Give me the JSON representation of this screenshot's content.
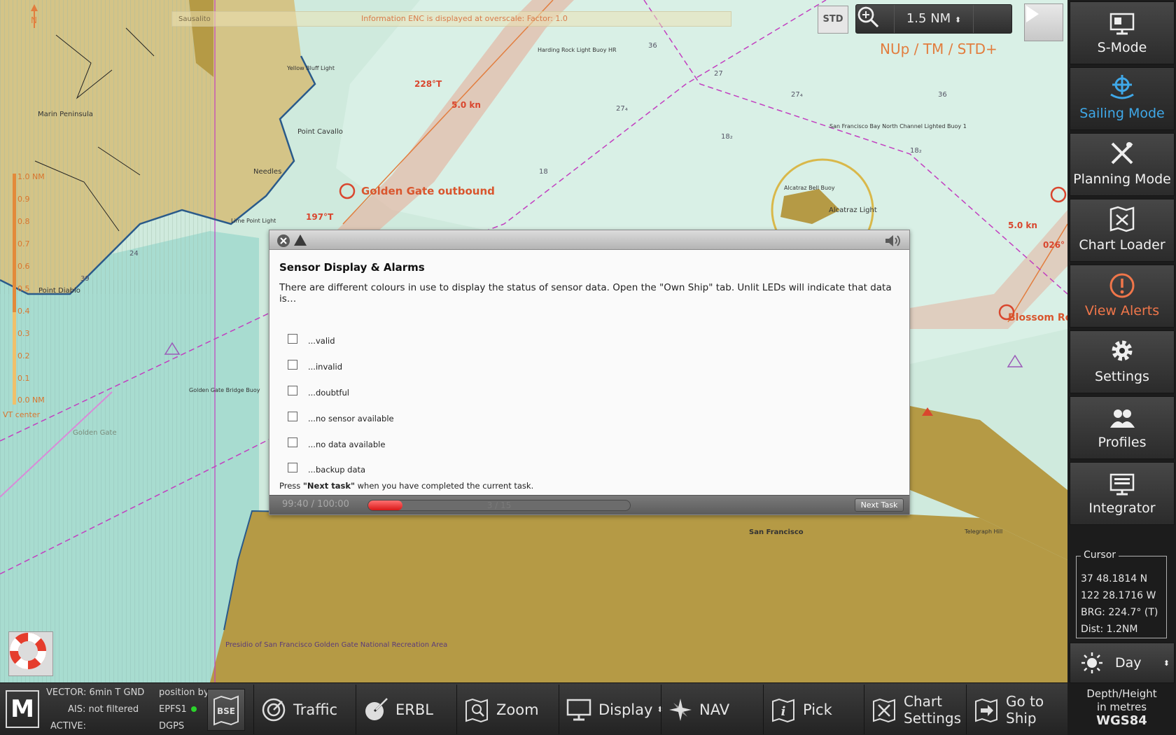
{
  "chart": {
    "info_banner": "Information ENC is displayed at overscale: Factor: 1.0",
    "place_sausalito": "Sausalito",
    "std_label": "STD",
    "zoom_value": "1.5 NM",
    "orientation_label": "NUp / TM / STD+",
    "labels": {
      "marin": "Marin Peninsula",
      "yellow_bluff": "Yellow Bluff Light",
      "point_cavallo": "Point Cavallo",
      "needles": "Needles",
      "point_diablo": "Point Diablo",
      "golden_gate_outbound": "Golden Gate outbound",
      "course_228": "228°T",
      "speed_5kn": "5.0 kn",
      "course_197": "197°T",
      "golden_gate": "Golden Gate",
      "golden_gate_bridge": "Golden Gate Bridge Buoy",
      "alcatraz": "Alcatraz Light",
      "alcatraz_bell": "Alcatraz Bell Buoy",
      "sf_bay_north": "San Francisco Bay North Channel Lighted Buoy 1",
      "blossom_rock": "Blossom Ro",
      "speed_right": "5.0 kn",
      "course_026": "026°",
      "harding": "Harding Rock Light Buoy HR",
      "lime_point": "Lime Point Light",
      "telegraph": "Telegraph Hill",
      "san_francisco": "San Francisco",
      "presidio": "Presidio of San Francisco Golden Gate National Recreation Area",
      "north": "N",
      "scale_top": "1.0 NM",
      "scale_bottom": "0.0 NM",
      "scale_ticks": [
        "0.9",
        "0.8",
        "0.7",
        "0.6",
        "0.5",
        "0.4",
        "0.3",
        "0.2",
        "0.1"
      ],
      "vct_center": "VT center",
      "depth_labels": [
        "36",
        "27",
        "18",
        "24",
        "39",
        "27₄",
        "18₂",
        "36",
        "27₄",
        "18₂"
      ]
    }
  },
  "dialog": {
    "title": "Sensor Display & Alarms",
    "description": "There are different colours in use to display the status of sensor data. Open the \"Own Ship\" tab. Unlit LEDs will indicate that data is…",
    "options": [
      "...valid",
      "...invalid",
      "...doubtful",
      "...no sensor available",
      "...no data available",
      "...backup data"
    ],
    "hint_prefix": "Press ",
    "hint_bold": "\"Next task\"",
    "hint_suffix": " when you have completed the current task.",
    "timer": "99:40 / 100:00",
    "progress_label": "3 / 15",
    "progress_fraction": 0.13,
    "next_label": "Next Task"
  },
  "sidepanel": {
    "buttons": [
      {
        "label": "S-Mode",
        "icon": "monitor-icon"
      },
      {
        "label": "Sailing Mode",
        "icon": "ship-wheel-icon",
        "active": true
      },
      {
        "label": "Planning Mode",
        "icon": "planning-tools-icon"
      },
      {
        "label": "Chart Loader",
        "icon": "chart-map-icon"
      },
      {
        "label": "View Alerts",
        "icon": "alert-icon"
      },
      {
        "label": "Settings",
        "icon": "gear-icon"
      },
      {
        "label": "Profiles",
        "icon": "users-icon"
      },
      {
        "label": "Integrator",
        "icon": "integrator-icon"
      }
    ],
    "cursor": {
      "legend": "Cursor",
      "lat": "37 48.1814 N",
      "lon": "122 28.1716 W",
      "brg": "BRG: 224.7° (T)",
      "dist": "Dist: 1.2NM"
    },
    "day_label": "Day",
    "depth_line1": "Depth/Height",
    "depth_line2": "in metres",
    "datum": "WGS84"
  },
  "bottombar": {
    "vector": "VECTOR: 6min T GND",
    "ais": "AIS: not filtered",
    "active": "ACTIVE:",
    "position_by": "position by",
    "epfs": "EPFS1",
    "dgps": "DGPS",
    "buttons": [
      {
        "label": "Traffic"
      },
      {
        "label": "ERBL"
      },
      {
        "label": "Zoom"
      },
      {
        "label": "Display"
      },
      {
        "label": "NAV"
      },
      {
        "label": "Pick"
      },
      {
        "label1": "Chart",
        "label2": "Settings"
      },
      {
        "label1": "Go to",
        "label2": "Ship"
      }
    ]
  },
  "colors": {
    "water_light": "#cfeadd",
    "water_shallow": "#a8dcd0",
    "land": "#b59a45",
    "land_light": "#d4c487",
    "route_orange": "#e27d3e",
    "boundary_magenta": "#c23fc0",
    "active_blue": "#3fa8e8",
    "alert_orange": "#f0764a"
  }
}
